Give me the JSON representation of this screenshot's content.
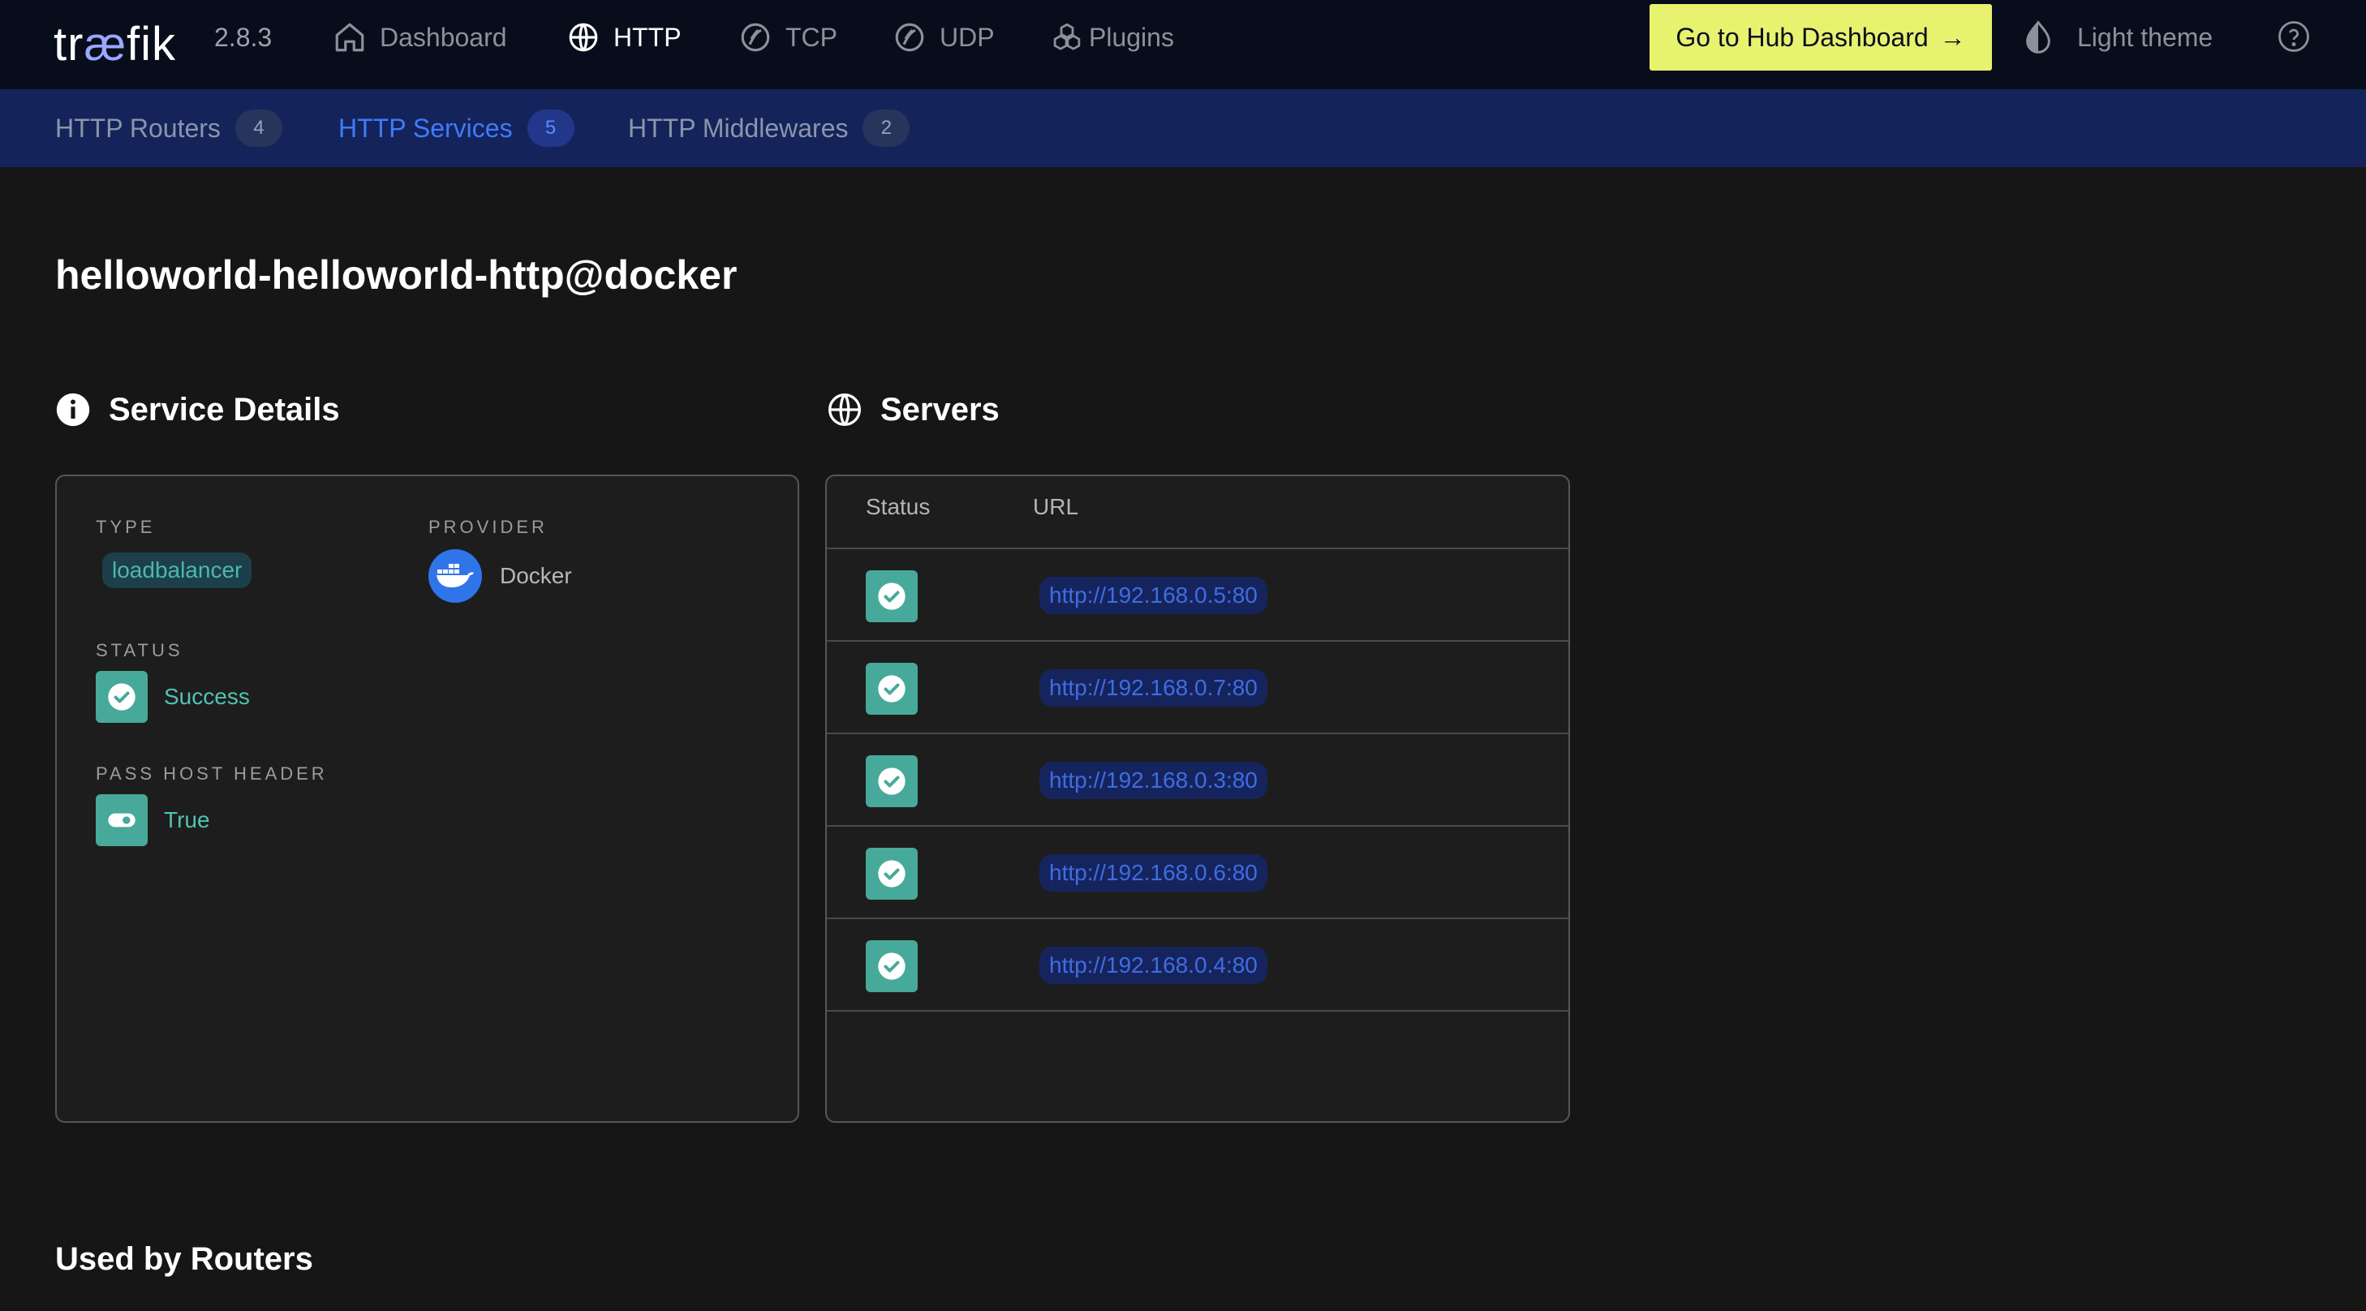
{
  "app": {
    "logo_pre": "tr",
    "logo_ae": "æ",
    "logo_post": "fik",
    "version": "2.8.3"
  },
  "nav": {
    "items": [
      {
        "label": "Dashboard",
        "icon": "home-icon",
        "active": false
      },
      {
        "label": "HTTP",
        "icon": "globe-icon",
        "active": true
      },
      {
        "label": "TCP",
        "icon": "tcp-icon",
        "active": false
      },
      {
        "label": "UDP",
        "icon": "udp-icon",
        "active": false
      },
      {
        "label": "Plugins",
        "icon": "plugins-icon",
        "active": false
      }
    ],
    "hub_button": "Go to Hub Dashboard",
    "hub_arrow": "→",
    "theme_label": "Light theme"
  },
  "subnav": {
    "tabs": [
      {
        "label": "HTTP Routers",
        "count": "4",
        "active": false
      },
      {
        "label": "HTTP Services",
        "count": "5",
        "active": true
      },
      {
        "label": "HTTP Middlewares",
        "count": "2",
        "active": false
      }
    ]
  },
  "page": {
    "title": "helloworld-helloworld-http@docker"
  },
  "service_details": {
    "title": "Service Details",
    "type_label": "TYPE",
    "type_value": "loadbalancer",
    "provider_label": "PROVIDER",
    "provider_value": "Docker",
    "status_label": "STATUS",
    "status_value": "Success",
    "pass_host_header_label": "PASS HOST HEADER",
    "pass_host_header_value": "True"
  },
  "servers": {
    "title": "Servers",
    "columns": {
      "status": "Status",
      "url": "URL"
    },
    "rows": [
      {
        "url": "http://192.168.0.5:80"
      },
      {
        "url": "http://192.168.0.7:80"
      },
      {
        "url": "http://192.168.0.3:80"
      },
      {
        "url": "http://192.168.0.6:80"
      },
      {
        "url": "http://192.168.0.4:80"
      }
    ]
  },
  "used_by": {
    "title": "Used by Routers"
  },
  "colors": {
    "topbar": "#080d1c",
    "subnav": "#14245a",
    "hub_button": "#e7f36f",
    "success": "#47a99a",
    "active_tab": "#3f7bff"
  }
}
